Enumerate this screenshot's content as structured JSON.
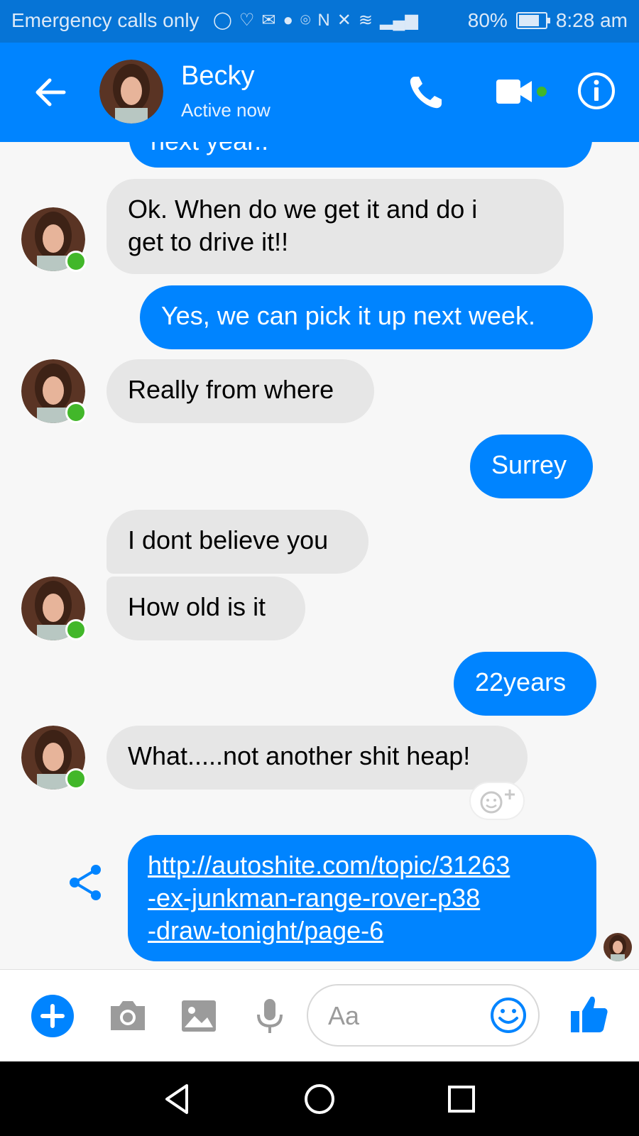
{
  "status_bar": {
    "carrier": "Emergency calls only",
    "battery": "80%",
    "time": "8:28 am"
  },
  "header": {
    "contact_name": "Becky",
    "contact_status": "Active now"
  },
  "messages": {
    "m0": "next year..",
    "m1_line1": "Ok. When do we get it and do i",
    "m1_line2": "get to drive it!!",
    "m2": "Yes, we can pick it up next week.",
    "m3": "Really from where",
    "m4": "Surrey",
    "m5": "I dont believe you",
    "m6": "How old is it",
    "m7": "22years",
    "m8": "What.....not another shit heap!",
    "m9_line1": "http://autoshite.com/topic/31263",
    "m9_line2": "-ex-junkman-range-rover-p38",
    "m9_line3": "-draw-tonight/page-6"
  },
  "composer": {
    "placeholder": "Aa"
  },
  "colors": {
    "brand_blue": "#0084ff",
    "statusbar_blue": "#0674d6",
    "incoming_bubble": "#e6e6e6",
    "presence_green": "#42b72a"
  },
  "icons": [
    "back-arrow-icon",
    "phone-icon",
    "video-camera-icon",
    "info-icon",
    "share-icon",
    "add-reaction-icon",
    "plus-icon",
    "camera-icon",
    "image-icon",
    "microphone-icon",
    "emoji-icon",
    "thumbs-up-icon",
    "nav-back-icon",
    "nav-home-icon",
    "nav-recents-icon"
  ]
}
